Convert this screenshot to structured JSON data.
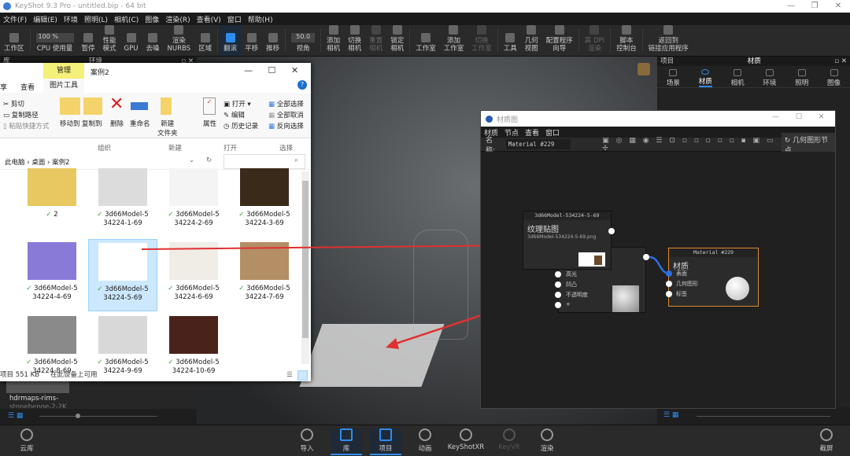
{
  "app": {
    "title": "KeyShot 9.3 Pro  - untitled.bip  - 64 bit",
    "window_controls": [
      "—",
      "❐",
      "✕"
    ]
  },
  "menu": [
    "文件(F)",
    "编辑(E)",
    "环境",
    "照明(L)",
    "相机(C)",
    "图像",
    "渲染(R)",
    "查看(V)",
    "窗口",
    "帮助(H)"
  ],
  "toolbar": {
    "cpu_value": "100 %",
    "fov_value": "50.0",
    "items": [
      {
        "label": "工作区",
        "state": "normal"
      },
      {
        "label": "CPU 使用量",
        "state": "normal"
      },
      {
        "label": "暂停",
        "state": "normal"
      },
      {
        "label": "性能\n模式",
        "state": "normal"
      },
      {
        "label": "GPU",
        "state": "normal"
      },
      {
        "label": "去噪",
        "state": "normal"
      },
      {
        "label": "渲染\nNURBS",
        "state": "normal"
      },
      {
        "label": "区域",
        "state": "normal"
      },
      {
        "label": "翻滚",
        "state": "active"
      },
      {
        "label": "平移",
        "state": "normal"
      },
      {
        "label": "推移",
        "state": "normal"
      },
      {
        "label": "视角",
        "state": "normal"
      },
      {
        "label": "添加\n相机",
        "state": "normal"
      },
      {
        "label": "切换\n相机",
        "state": "normal"
      },
      {
        "label": "重置\n相机",
        "state": "disabled"
      },
      {
        "label": "锁定\n相机",
        "state": "normal"
      },
      {
        "label": "工作室",
        "state": "normal"
      },
      {
        "label": "添加\n工作室",
        "state": "normal"
      },
      {
        "label": "切换\n工作室",
        "state": "disabled"
      },
      {
        "label": "工具",
        "state": "normal"
      },
      {
        "label": "几何\n视图",
        "state": "normal"
      },
      {
        "label": "配置程序\n向导",
        "state": "normal"
      },
      {
        "label": "高 DPI\n渲染",
        "state": "disabled"
      },
      {
        "label": "脚本\n控制台",
        "state": "normal"
      },
      {
        "label": "返回到\n链接应用程序",
        "state": "normal"
      }
    ]
  },
  "left_panel": {
    "header_left": "库",
    "header_title": "环境",
    "thumb_label": "hdrmaps-rims-",
    "thumb_label2": "stonehenge-2-2K"
  },
  "right_panel": {
    "header_left": "项目",
    "header_title": "材质",
    "tabs": [
      {
        "label": "场景"
      },
      {
        "label": "材质",
        "active": true
      },
      {
        "label": "相机"
      },
      {
        "label": "环境"
      },
      {
        "label": "照明"
      },
      {
        "label": "图像"
      }
    ]
  },
  "explorer": {
    "tab_manage": "管理",
    "title": "案例2",
    "tab_share": "享",
    "tab_view": "查看",
    "tab_picture_tools": "图片工具",
    "clipboard": [
      "剪切",
      "复制路径",
      "粘贴快捷方式"
    ],
    "organize": [
      "移动到",
      "复制到",
      "删除",
      "重命名"
    ],
    "new_folder": "新建\n文件夹",
    "open": [
      "打开 ▾",
      "编辑",
      "历史记录"
    ],
    "properties": "属性",
    "select": [
      "全部选择",
      "全部取消",
      "反向选择"
    ],
    "groups": [
      "组织",
      "新建",
      "打开",
      "选择"
    ],
    "breadcrumb": [
      "此电脑",
      "桌面",
      "案例2"
    ],
    "files": [
      {
        "l1": "2",
        "l2": "",
        "thumb": "#e8c860"
      },
      {
        "l1": "3d66Model-5",
        "l2": "34224-1-69",
        "thumb": "#dcdcdc"
      },
      {
        "l1": "3d66Model-5",
        "l2": "34224-2-69",
        "thumb": "#f4f4f4"
      },
      {
        "l1": "3d66Model-5",
        "l2": "34224-3-69",
        "thumb": "#3a2a1a"
      },
      {
        "l1": "3d66Model-5",
        "l2": "34224-4-69",
        "thumb": "#8a7ad8"
      },
      {
        "l1": "3d66Model-5",
        "l2": "34224-5-69",
        "thumb": "#ffffff",
        "selected": true
      },
      {
        "l1": "3d66Model-5",
        "l2": "34224-6-69",
        "thumb": "#f0ece6"
      },
      {
        "l1": "3d66Model-5",
        "l2": "34224-7-69",
        "thumb": "#b48e64"
      },
      {
        "l1": "3d66Model-5",
        "l2": "34224-8-69",
        "thumb": "#8a8a8a"
      },
      {
        "l1": "3d66Model-5",
        "l2": "34224-9-69",
        "thumb": "#d8d8d8"
      },
      {
        "l1": "3d66Model-5",
        "l2": "34224-10-69",
        "thumb": "#4a221c"
      }
    ],
    "status_items": "项目  551 KB",
    "status_avail": "在此设备上可用"
  },
  "material_graph": {
    "title": "材质图",
    "menu": [
      "材质",
      "节点",
      "查看",
      "窗口"
    ],
    "name_label": "名称:",
    "name_value": "Material #229",
    "geometry_node_button": "几何图形节点",
    "texture_node": {
      "header": "3d66Model-534224-5-69",
      "title": "纹理贴图",
      "file": "3d66Model-534224-5-69.png"
    },
    "material_node": {
      "header": "Material #229",
      "title": "材质",
      "ports": [
        "表面",
        "几何图形",
        "标签"
      ]
    },
    "bump_node": {
      "ports": [
        "高光",
        "凹凸",
        "不透明度",
        "+"
      ]
    },
    "accent": "#e08a2e",
    "link": "#2d6fe0"
  },
  "bottom": {
    "items": [
      {
        "label": "云库"
      },
      {
        "label": "导入"
      },
      {
        "label": "库",
        "active": true
      },
      {
        "label": "项目",
        "active": true
      },
      {
        "label": "动画"
      },
      {
        "label": "KeyShotXR"
      },
      {
        "label": "KeyVR",
        "disabled": true
      },
      {
        "label": "渲染"
      },
      {
        "label": "截屏"
      }
    ]
  }
}
